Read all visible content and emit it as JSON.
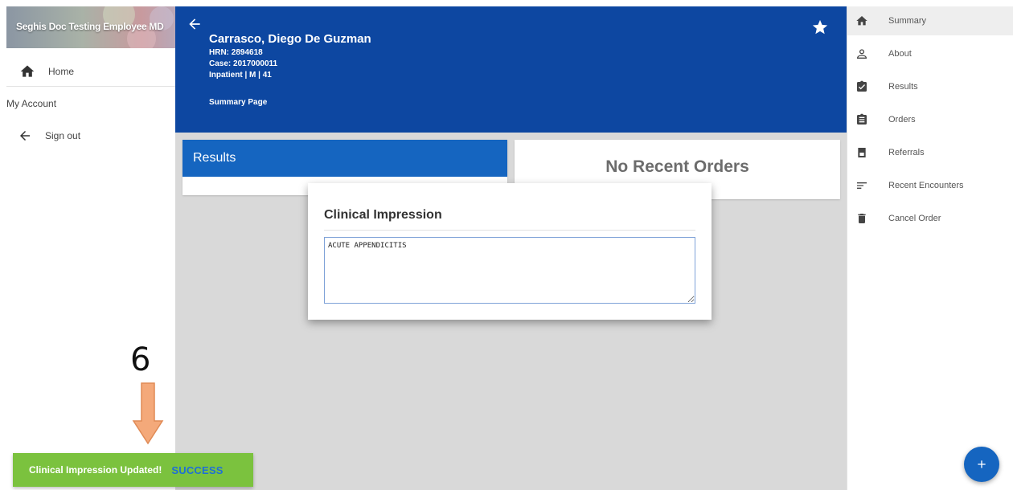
{
  "left_drawer": {
    "user_name": "Seghis Doc Testing Employee MD",
    "home_icon": "home-icon",
    "home_label": "Home",
    "my_account_label": "My Account",
    "sign_out_icon": "arrow-left-icon",
    "sign_out_label": "Sign out"
  },
  "header": {
    "back_icon": "arrow-left-icon",
    "patient_name": "Carrasco, Diego De Guzman",
    "hrn": "HRN: 2894618",
    "case": "Case: 2017000011",
    "encounter": "Inpatient | M | 41",
    "page_name": "Summary Page",
    "favorite_icon": "star-icon"
  },
  "cards": {
    "results_title": "Results",
    "orders_empty_text": "No Recent Orders"
  },
  "dialog": {
    "title": "Clinical Impression",
    "value": "ACUTE APPENDICITIS"
  },
  "right_nav": {
    "items": [
      {
        "label": "Summary",
        "icon": "home-icon",
        "active": true
      },
      {
        "label": "About",
        "icon": "person-icon"
      },
      {
        "label": "Results",
        "icon": "clipboard-check-icon"
      },
      {
        "label": "Orders",
        "icon": "clipboard-icon"
      },
      {
        "label": "Referrals",
        "icon": "referral-icon"
      },
      {
        "label": "Recent Encounters",
        "icon": "list-icon"
      },
      {
        "label": "Cancel Order",
        "icon": "trash-icon"
      }
    ],
    "fab_icon": "plus-icon"
  },
  "toast": {
    "message": "Clinical Impression Updated!",
    "action": "SUCCESS",
    "color": "#7bc23e"
  },
  "annotation": {
    "step_number": "6",
    "arrow_color": "#f4a97a"
  },
  "colors": {
    "header_blue": "#0d47a1",
    "card_blue": "#1565c0",
    "fab_blue": "#1565c0"
  }
}
